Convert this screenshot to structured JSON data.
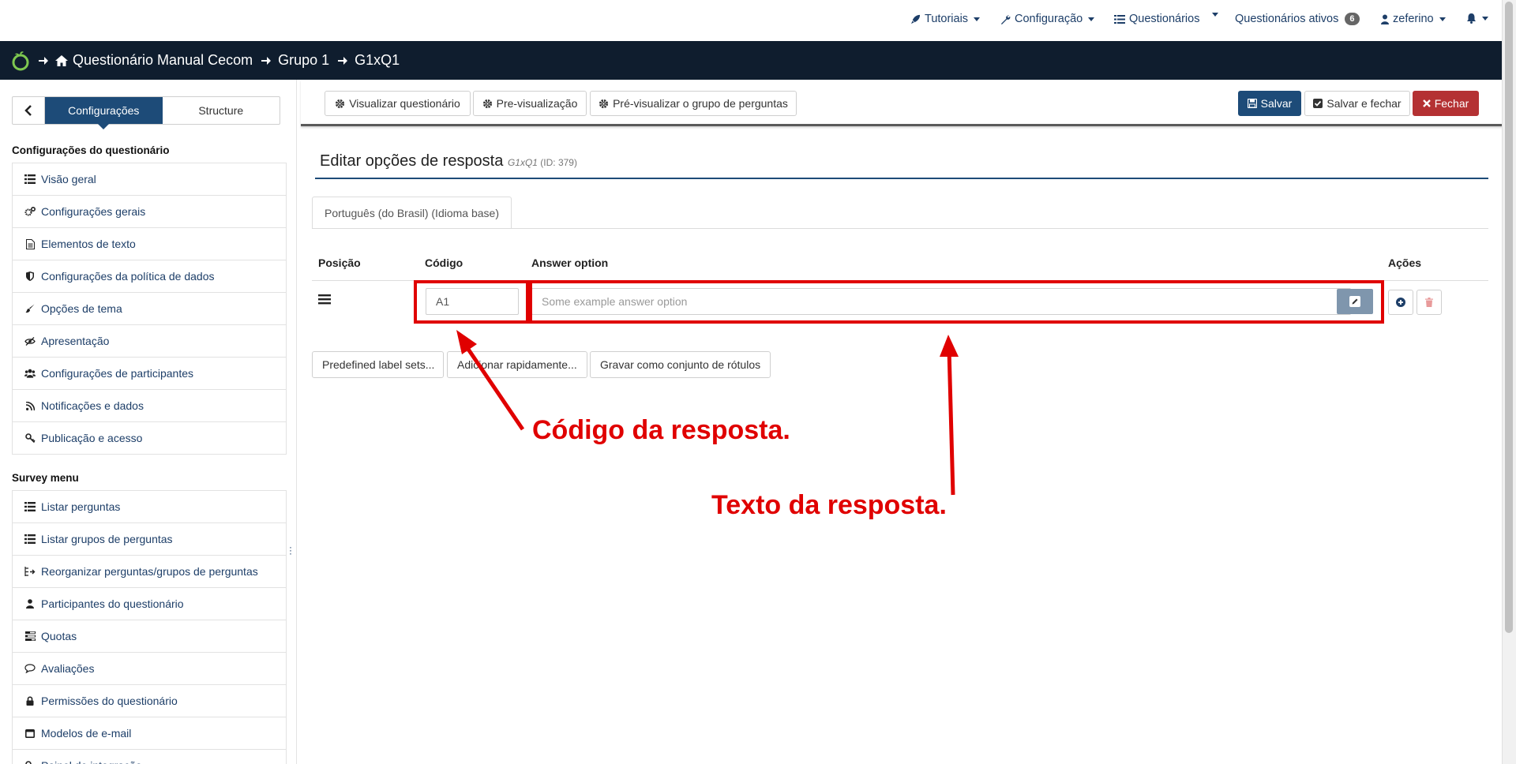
{
  "topnav": {
    "tutorials": "Tutoriais",
    "configuration": "Configuração",
    "surveys": "Questionários",
    "active_surveys": "Questionários ativos",
    "active_count": "6",
    "user": "zeferino"
  },
  "breadcrumb": {
    "survey": "Questionário Manual Cecom",
    "group": "Grupo 1",
    "question": "G1xQ1"
  },
  "sidebar": {
    "tab_settings": "Configurações",
    "tab_structure": "Structure",
    "section_settings": "Configurações do questionário",
    "settings_items": [
      {
        "label": "Visão geral",
        "icon": "list-icon"
      },
      {
        "label": "Configurações gerais",
        "icon": "gears-icon"
      },
      {
        "label": "Elementos de texto",
        "icon": "file-text-icon"
      },
      {
        "label": "Configurações da política de dados",
        "icon": "shield-icon"
      },
      {
        "label": "Opções de tema",
        "icon": "paint-brush-icon"
      },
      {
        "label": "Apresentação",
        "icon": "eye-slash-icon"
      },
      {
        "label": "Configurações de participantes",
        "icon": "users-icon"
      },
      {
        "label": "Notificações e dados",
        "icon": "rss-icon"
      },
      {
        "label": "Publicação e acesso",
        "icon": "key-icon"
      }
    ],
    "section_menu": "Survey menu",
    "menu_items": [
      {
        "label": "Listar perguntas",
        "icon": "list-icon"
      },
      {
        "label": "Listar grupos de perguntas",
        "icon": "list-icon"
      },
      {
        "label": "Reorganizar perguntas/grupos de perguntas",
        "icon": "reorder-icon"
      },
      {
        "label": "Participantes do questionário",
        "icon": "user-icon"
      },
      {
        "label": "Quotas",
        "icon": "tasks-icon"
      },
      {
        "label": "Avaliações",
        "icon": "comment-icon"
      },
      {
        "label": "Permissões do questionário",
        "icon": "lock-icon"
      },
      {
        "label": "Modelos de e-mail",
        "icon": "window-icon"
      },
      {
        "label": "Painel de integração",
        "icon": "plug-icon"
      }
    ]
  },
  "toolbar": {
    "view_survey": "Visualizar questionário",
    "preview": "Pre-visualização",
    "preview_group": "Pré-visualizar o grupo de perguntas",
    "save": "Salvar",
    "save_close": "Salvar e fechar",
    "close": "Fechar"
  },
  "page": {
    "title": "Editar opções de resposta",
    "code_ref": "G1xQ1",
    "id_ref": "(ID: 379)",
    "language_tab": "Português (do Brasil) (Idioma base)"
  },
  "table": {
    "headers": {
      "position": "Posição",
      "code": "Código",
      "answer": "Answer option",
      "actions": "Ações"
    },
    "row": {
      "code": "A1",
      "answer_placeholder": "Some example answer option"
    }
  },
  "buttons": {
    "predefined": "Predefined label sets...",
    "quick_add": "Adicionar rapidamente...",
    "save_label_set": "Gravar como conjunto de rótulos"
  },
  "annotations": {
    "code": "Código da resposta.",
    "text": "Texto da resposta."
  },
  "colors": {
    "navy": "#1d4b78",
    "dark_bar": "#0f1d2e",
    "danger": "#b43133",
    "annotation_red": "#e00000"
  }
}
